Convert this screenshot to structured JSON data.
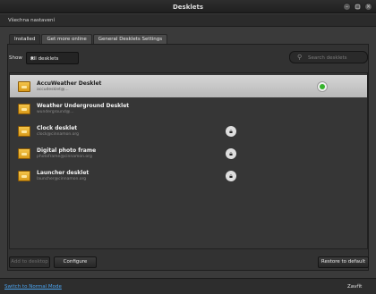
{
  "window": {
    "title": "Desklets"
  },
  "header": {
    "all_settings": "Všechna nastavení"
  },
  "tabs": [
    {
      "label": "Installed",
      "active": true
    },
    {
      "label": "Get more online",
      "active": false
    },
    {
      "label": "General Desklets Settings",
      "active": false
    }
  ],
  "filter": {
    "show_label": "Show",
    "selected": "All desklets"
  },
  "search": {
    "placeholder": "Search desklets"
  },
  "desklets": [
    {
      "name": "AccuWeather Desklet",
      "uuid": "accudesklet@...",
      "selected": true,
      "status": "enabled"
    },
    {
      "name": "Weather Underground Desklet",
      "uuid": "wunderground@...",
      "selected": false,
      "status": "none"
    },
    {
      "name": "Clock desklet",
      "uuid": "clock@cinnamon.org",
      "selected": false,
      "status": "locked"
    },
    {
      "name": "Digital photo frame",
      "uuid": "photoframe@cinnamon.org",
      "selected": false,
      "status": "locked"
    },
    {
      "name": "Launcher desklet",
      "uuid": "launcher@cinnamon.org",
      "selected": false,
      "status": "locked"
    }
  ],
  "buttons": {
    "add": "Add to desktop",
    "configure": "Configure",
    "restore": "Restore to default"
  },
  "footer": {
    "normal_mode": "Switch to Normal Mode",
    "close": "Zavřít"
  },
  "colors": {
    "accent_link": "#4ba4f0",
    "enabled_dot": "#36b32d"
  }
}
